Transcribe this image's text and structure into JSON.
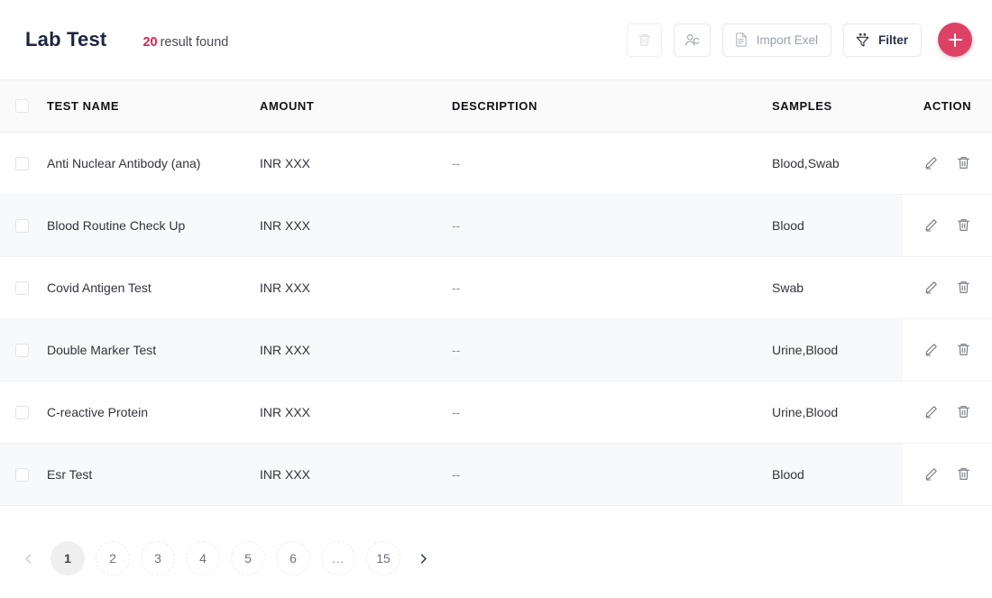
{
  "header": {
    "title": "Lab Test",
    "result_count": "20",
    "result_text": "result found",
    "accent_color": "#e0224e",
    "add_button_color": "#dd4266"
  },
  "toolbar": {
    "delete_label": "",
    "delete_icon": "trash-icon",
    "assign_user_icon": "user-remove-icon",
    "import_label": "Import Exel",
    "import_icon": "document-icon",
    "filter_label": "Filter",
    "filter_icon": "funnel-icon",
    "add_label": "+",
    "add_icon": "plus-icon"
  },
  "table": {
    "columns": [
      "TEST NAME",
      "AMOUNT",
      "DESCRIPTION",
      "SAMPLES",
      "ACTION"
    ],
    "rows": [
      {
        "name": "Anti Nuclear Antibody (ana)",
        "amount": "INR XXX",
        "description": "--",
        "samples": "Blood,Swab"
      },
      {
        "name": "Blood Routine Check Up",
        "amount": "INR XXX",
        "description": "--",
        "samples": "Blood"
      },
      {
        "name": "Covid Antigen Test",
        "amount": "INR XXX",
        "description": "--",
        "samples": "Swab"
      },
      {
        "name": "Double Marker Test",
        "amount": "INR XXX",
        "description": "--",
        "samples": "Urine,Blood"
      },
      {
        "name": "C-reactive Protein",
        "amount": "INR XXX",
        "description": "--",
        "samples": "Urine,Blood"
      },
      {
        "name": "Esr Test",
        "amount": "INR XXX",
        "description": "--",
        "samples": "Blood"
      }
    ],
    "row_action_edit_icon": "pencil-icon",
    "row_action_delete_icon": "trash-icon"
  },
  "pagination": {
    "prev_icon": "chevron-left-icon",
    "next_icon": "chevron-right-icon",
    "pages": [
      "1",
      "2",
      "3",
      "4",
      "5",
      "6",
      "...",
      "15"
    ],
    "active_page": "1"
  }
}
